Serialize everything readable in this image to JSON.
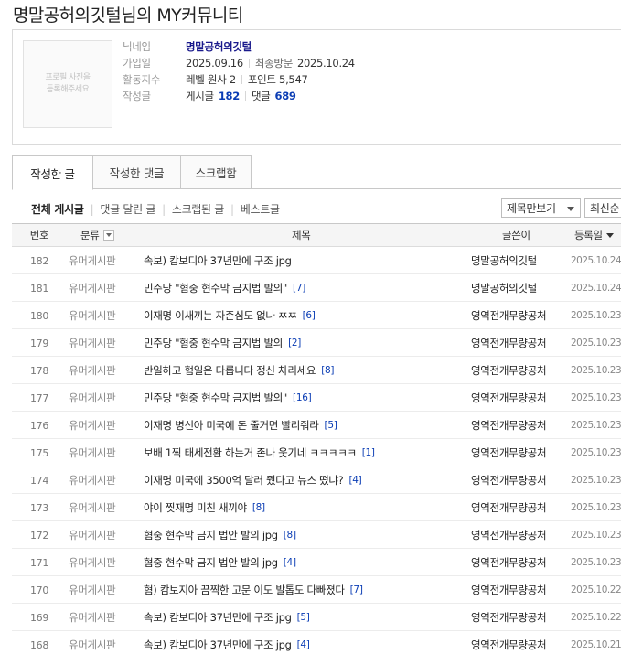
{
  "page": {
    "title": "명말공허의깃털님의 MY커뮤니티"
  },
  "profile": {
    "avatar_placeholder": [
      "프로필 사진을",
      "등록해주세요"
    ],
    "labels": {
      "nick": "닉네임",
      "joined": "가입일",
      "activity": "활동지수",
      "posts": "작성글"
    },
    "nickname": "명말공허의깃털",
    "joined": "2025.09.16",
    "last_visit_label": "최종방문",
    "last_visit": "2025.10.24",
    "level": "레벨 원사 2",
    "points": "포인트 5,547",
    "posts_label": "게시글",
    "posts_count": "182",
    "comments_label": "댓글",
    "comments_count": "689"
  },
  "tabs": [
    "작성한 글",
    "작성한 댓글",
    "스크랩함"
  ],
  "filters": [
    "전체 게시글",
    "댓글 달린 글",
    "스크랩된 글",
    "베스트글"
  ],
  "view_select": "제목만보기",
  "sort_select": "최신순",
  "table": {
    "headers": {
      "no": "번호",
      "category": "분류",
      "title": "제목",
      "writer": "글쓴이",
      "date": "등록일"
    },
    "rows": [
      {
        "no": "182",
        "category": "유머게시판",
        "title": "속보) 캄보디아 37년만에 구조 jpg",
        "comments": "",
        "writer": "명말공허의깃털",
        "date": "2025.10.24"
      },
      {
        "no": "181",
        "category": "유머게시판",
        "title": "민주당 \"혐중 현수막 금지법 발의\"",
        "comments": "[7]",
        "writer": "명말공허의깃털",
        "date": "2025.10.24"
      },
      {
        "no": "180",
        "category": "유머게시판",
        "title": "이재명 이새끼는 자존심도 없나 ㅉㅉ",
        "comments": "[6]",
        "writer": "영역전개무량공처",
        "date": "2025.10.23"
      },
      {
        "no": "179",
        "category": "유머게시판",
        "title": "민주당 \"혐중 현수막 금지법 발의",
        "comments": "[2]",
        "writer": "영역전개무량공처",
        "date": "2025.10.23"
      },
      {
        "no": "178",
        "category": "유머게시판",
        "title": "반일하고 혐일은 다릅니다 정신 차리세요",
        "comments": "[8]",
        "writer": "영역전개무량공처",
        "date": "2025.10.23"
      },
      {
        "no": "177",
        "category": "유머게시판",
        "title": "민주당 \"혐중 현수막 금지법 발의\"",
        "comments": "[16]",
        "writer": "영역전개무량공처",
        "date": "2025.10.23"
      },
      {
        "no": "176",
        "category": "유머게시판",
        "title": "이재명 병신아 미국에 돈 줄거면 빨리줘라",
        "comments": "[5]",
        "writer": "영역전개무량공처",
        "date": "2025.10.23"
      },
      {
        "no": "175",
        "category": "유머게시판",
        "title": "보배 1찍 태세전환 하는거 존나 웃기네 ㅋㅋㅋㅋㅋ",
        "comments": "[1]",
        "writer": "영역전개무량공처",
        "date": "2025.10.23"
      },
      {
        "no": "174",
        "category": "유머게시판",
        "title": "이재명 미국에 3500억 달러 줬다고 뉴스 떴냐?",
        "comments": "[4]",
        "writer": "영역전개무량공처",
        "date": "2025.10.23"
      },
      {
        "no": "173",
        "category": "유머게시판",
        "title": "야이 찢재명 미친 새끼야",
        "comments": "[8]",
        "writer": "영역전개무량공처",
        "date": "2025.10.23"
      },
      {
        "no": "172",
        "category": "유머게시판",
        "title": "혐중 현수막 금지 법안 발의 jpg",
        "comments": "[8]",
        "writer": "영역전개무량공처",
        "date": "2025.10.23"
      },
      {
        "no": "171",
        "category": "유머게시판",
        "title": "혐중 현수막 금지 법안 발의 jpg",
        "comments": "[4]",
        "writer": "영역전개무량공처",
        "date": "2025.10.23"
      },
      {
        "no": "170",
        "category": "유머게시판",
        "title": "혐) 캄보지아 끔찍한 고문 이도 발톱도 다빠졌다",
        "comments": "[7]",
        "writer": "영역전개무량공처",
        "date": "2025.10.22"
      },
      {
        "no": "169",
        "category": "유머게시판",
        "title": "속보) 캄보디아 37년만에 구조 jpg",
        "comments": "[5]",
        "writer": "영역전개무량공처",
        "date": "2025.10.22"
      },
      {
        "no": "168",
        "category": "유머게시판",
        "title": "속보) 캄보디아 37년만에 구조 jpg",
        "comments": "[4]",
        "writer": "영역전개무량공처",
        "date": "2025.10.21"
      }
    ]
  }
}
